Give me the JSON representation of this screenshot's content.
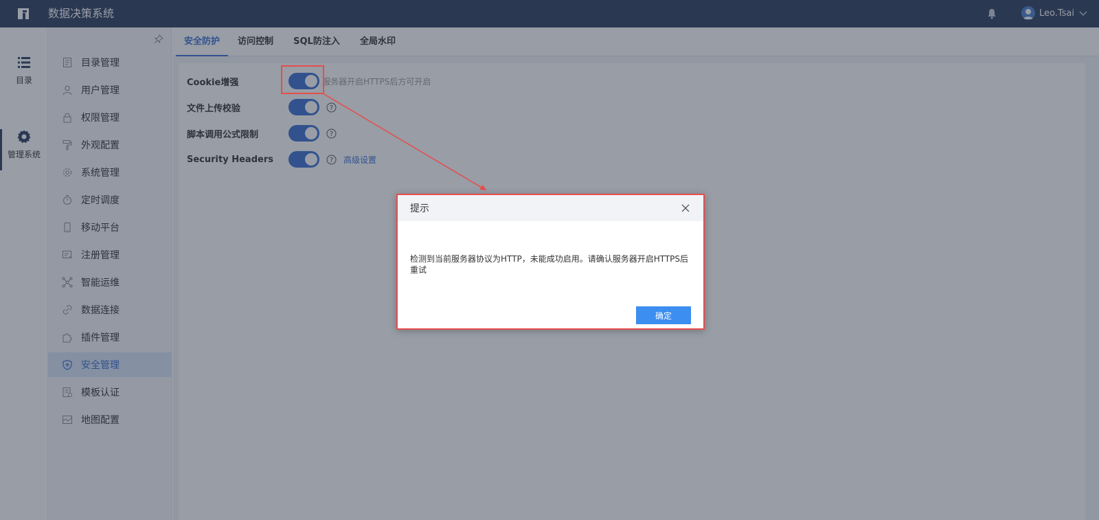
{
  "header": {
    "app_title": "数据决策系统",
    "user_name": "Leo.Tsai"
  },
  "navbar": {
    "items": [
      {
        "label": "目录",
        "icon": "list-icon"
      },
      {
        "label": "管理系统",
        "icon": "gear-icon"
      }
    ]
  },
  "sidebar": {
    "items": [
      {
        "label": "目录管理",
        "icon": "directory-icon"
      },
      {
        "label": "用户管理",
        "icon": "user-icon"
      },
      {
        "label": "权限管理",
        "icon": "lock-icon"
      },
      {
        "label": "外观配置",
        "icon": "paint-roller-icon"
      },
      {
        "label": "系统管理",
        "icon": "settings-icon"
      },
      {
        "label": "定时调度",
        "icon": "stopwatch-icon"
      },
      {
        "label": "移动平台",
        "icon": "mobile-icon"
      },
      {
        "label": "注册管理",
        "icon": "register-icon"
      },
      {
        "label": "智能运维",
        "icon": "network-icon"
      },
      {
        "label": "数据连接",
        "icon": "link-icon"
      },
      {
        "label": "插件管理",
        "icon": "puzzle-icon"
      },
      {
        "label": "安全管理",
        "icon": "shield-icon"
      },
      {
        "label": "模板认证",
        "icon": "certificate-icon"
      },
      {
        "label": "地图配置",
        "icon": "map-icon"
      }
    ],
    "active_index": 11
  },
  "tabs": [
    {
      "label": "安全防护"
    },
    {
      "label": "访问控制"
    },
    {
      "label": "SQL防注入"
    },
    {
      "label": "全局水印"
    }
  ],
  "settings": [
    {
      "label": "Cookie增强",
      "enabled": true,
      "hint": "服务器开启HTTPS后方可开启"
    },
    {
      "label": "文件上传校验",
      "enabled": true
    },
    {
      "label": "脚本调用公式限制",
      "enabled": true
    },
    {
      "label": "Security Headers",
      "enabled": true,
      "link": "高级设置"
    }
  ],
  "dialog": {
    "title": "提示",
    "message": "检测到当前服务器协议为HTTP，未能成功启用。请确认服务器开启HTTPS后重试",
    "ok_label": "确定"
  },
  "colors": {
    "topbar": "#2f3e5e",
    "accent": "#3c6fd1",
    "primary_button": "#3c8ef0",
    "highlight_red": "#e84c4c"
  }
}
